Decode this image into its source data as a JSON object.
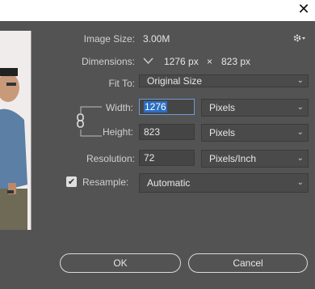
{
  "window": {
    "close_glyph": "✕"
  },
  "image_size": {
    "label": "Image Size:",
    "value": "3.00M"
  },
  "dimensions": {
    "label": "Dimensions:",
    "width": "1276 px",
    "times": "×",
    "height": "823 px"
  },
  "fit_to": {
    "label": "Fit To:",
    "value": "Original Size"
  },
  "width": {
    "label": "Width:",
    "value": "1276",
    "unit": "Pixels"
  },
  "height": {
    "label": "Height:",
    "value": "823",
    "unit": "Pixels"
  },
  "resolution": {
    "label": "Resolution:",
    "value": "72",
    "unit": "Pixels/Inch"
  },
  "resample": {
    "label": "Resample:",
    "value": "Automatic",
    "checked": true
  },
  "buttons": {
    "ok": "OK",
    "cancel": "Cancel"
  },
  "colors": {
    "panel": "#535353",
    "selection": "#2a6fc4",
    "field": "#454545"
  },
  "icons": [
    "close-icon",
    "gear-icon",
    "chevron-down-icon",
    "chain-link-icon",
    "checkmark-icon"
  ]
}
